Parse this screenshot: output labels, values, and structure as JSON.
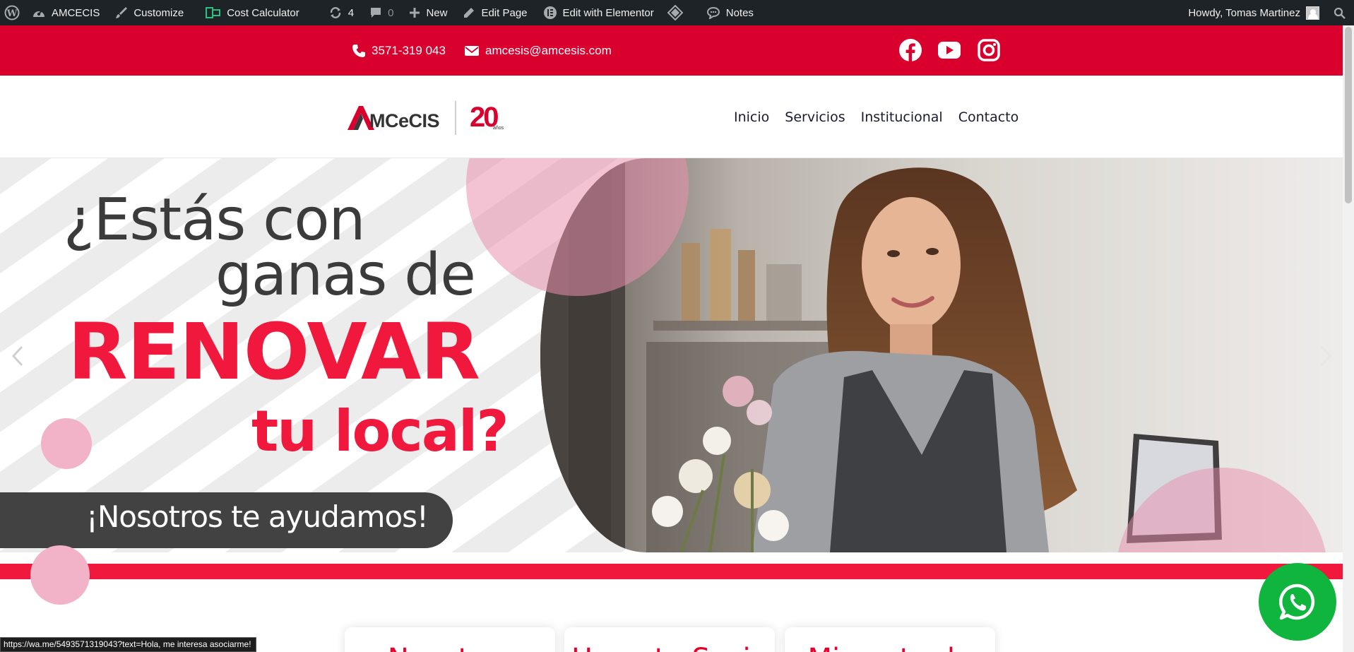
{
  "admin_bar": {
    "site_name": "AMCECIS",
    "customize": "Customize",
    "cost_calculator": "Cost Calculator",
    "updates_count": "4",
    "comments_count": "0",
    "new_label": "New",
    "edit_page": "Edit Page",
    "edit_elementor": "Edit with Elementor",
    "notes": "Notes",
    "greeting": "Howdy, Tomas Martinez"
  },
  "topbar": {
    "phone": "3571-319 043",
    "email": "amcesis@amcesis.com",
    "social": [
      "facebook-icon",
      "youtube-icon",
      "instagram-icon"
    ]
  },
  "header": {
    "logo_text": "MCeCIS",
    "logo_badge_main": "20",
    "logo_badge_sub": "años",
    "nav": [
      "Inicio",
      "Servicios",
      "Institucional",
      "Contacto"
    ]
  },
  "hero": {
    "line1": "¿Estás con",
    "line2": "ganas de",
    "line3": "RENOVAR",
    "line4": "tu local?",
    "pill": "¡Nosotros te ayudamos!"
  },
  "cards": [
    {
      "title": "Nosotros"
    },
    {
      "title": "Hacerte Socio"
    },
    {
      "title": "Mi cuota de"
    }
  ],
  "status_url": "https://wa.me/5493571319043?text=Hola, me interesa asociarme!",
  "colors": {
    "brand_red": "#d9002e",
    "accent_red": "#f0183c",
    "admin_bar": "#1d2327",
    "whatsapp": "#0fb53c",
    "pink_circle": "#f2b3c8"
  }
}
